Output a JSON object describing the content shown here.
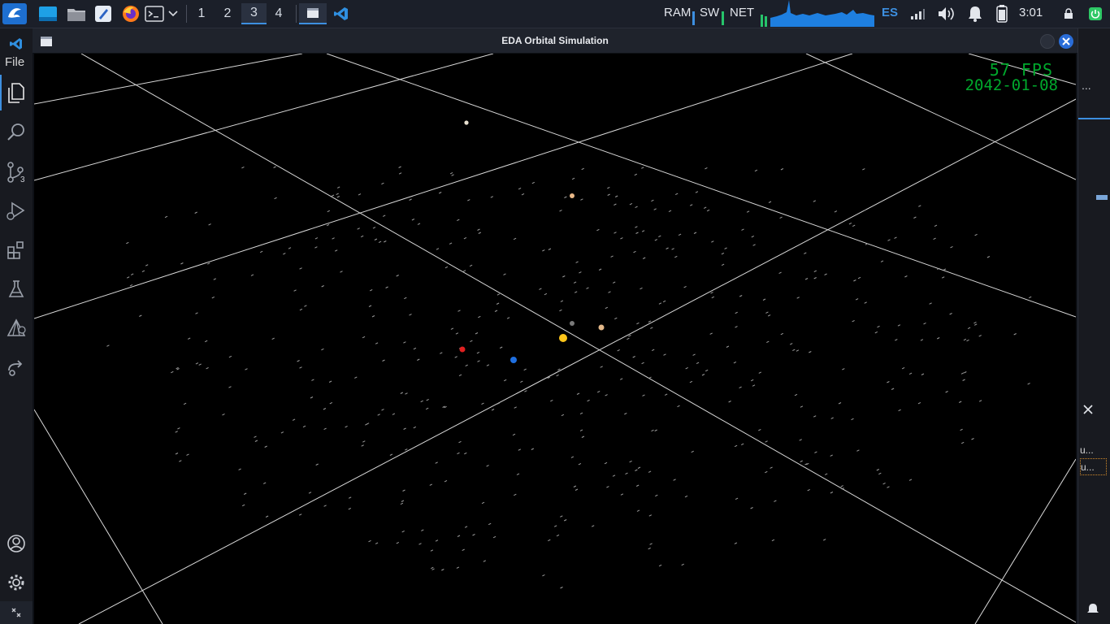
{
  "taskbar": {
    "workspaces": [
      {
        "label": "1",
        "active": false
      },
      {
        "label": "2",
        "active": false
      },
      {
        "label": "3",
        "active": true
      },
      {
        "label": "4",
        "active": false
      }
    ],
    "tray": {
      "ram_label": "RAM",
      "swap_label": "SW",
      "net_label": "NET",
      "keyboard_layout": "ES",
      "clock": "3:01"
    }
  },
  "vscode": {
    "file_menu_label": "File",
    "scm_badge": "3",
    "right_panel_items": [
      "u...",
      "u..."
    ],
    "right_panel_more": "..."
  },
  "window": {
    "title": "EDA Orbital Simulation"
  },
  "simulation": {
    "fps_text": "57 FPS",
    "date_text": "2042-01-08",
    "bodies": [
      {
        "name": "sun",
        "color": "#ffc61a"
      },
      {
        "name": "mercury",
        "color": "#7a7a7a"
      },
      {
        "name": "venus",
        "color": "#e3b88a"
      },
      {
        "name": "earth",
        "color": "#1f6fe0"
      },
      {
        "name": "mars",
        "color": "#e02020"
      },
      {
        "name": "jupiter",
        "color": "#e8b888"
      },
      {
        "name": "far-body",
        "color": "#e8e0d0"
      }
    ]
  },
  "colors": {
    "accent": "#3d8fe0",
    "hud_green": "#00a82c",
    "close_button": "#2a6dd8"
  }
}
